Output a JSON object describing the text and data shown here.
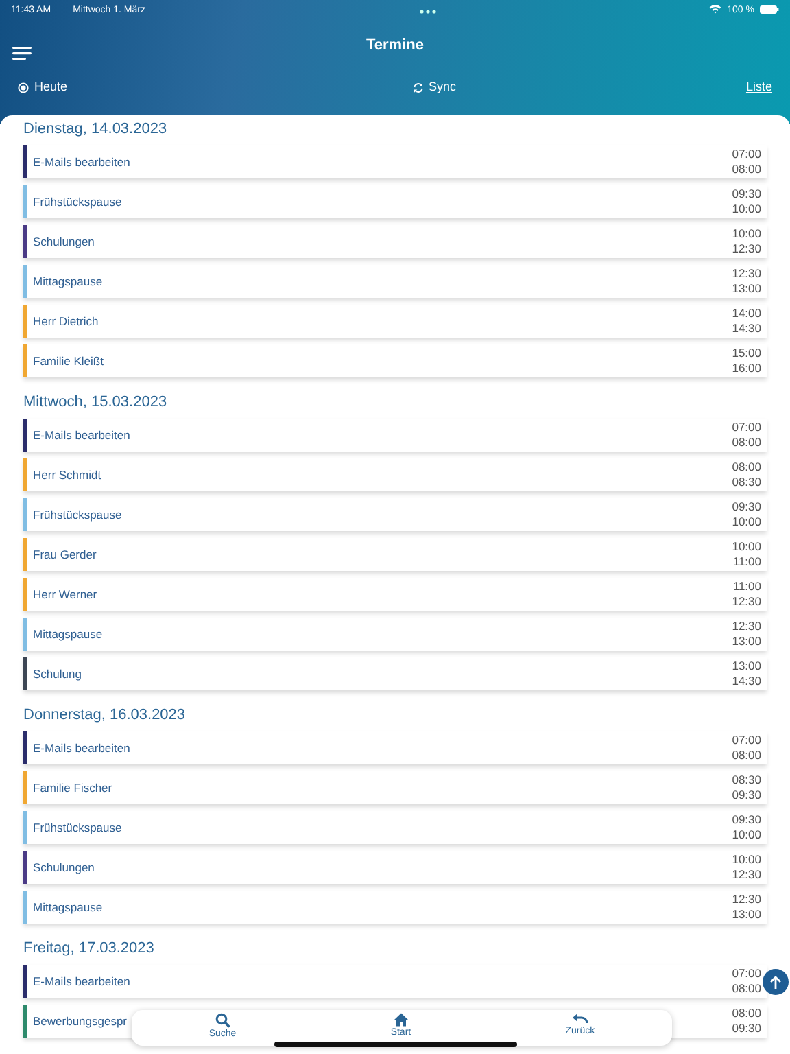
{
  "status_bar": {
    "time": "11:43 AM",
    "date": "Mittwoch 1. März",
    "battery": "100 %"
  },
  "header": {
    "title": "Termine"
  },
  "toolbar": {
    "today": "Heute",
    "sync": "Sync",
    "list": "Liste"
  },
  "days": [
    {
      "heading": "Dienstag, 14.03.2023",
      "events": [
        {
          "title": "E-Mails bearbeiten",
          "start": "07:00",
          "end": "08:00",
          "color": "#2b2d6b"
        },
        {
          "title": "Frühstückspause",
          "start": "09:30",
          "end": "10:00",
          "color": "#80bde3"
        },
        {
          "title": "Schulungen",
          "start": "10:00",
          "end": "12:30",
          "color": "#4b3b86"
        },
        {
          "title": "Mittagspause",
          "start": "12:30",
          "end": "13:00",
          "color": "#80bde3"
        },
        {
          "title": "Herr Dietrich",
          "start": "14:00",
          "end": "14:30",
          "color": "#f0a732"
        },
        {
          "title": "Familie Kleißt",
          "start": "15:00",
          "end": "16:00",
          "color": "#f0a732"
        }
      ]
    },
    {
      "heading": "Mittwoch, 15.03.2023",
      "events": [
        {
          "title": "E-Mails bearbeiten",
          "start": "07:00",
          "end": "08:00",
          "color": "#2b2d6b"
        },
        {
          "title": "Herr Schmidt",
          "start": "08:00",
          "end": "08:30",
          "color": "#f0a732"
        },
        {
          "title": "Frühstückspause",
          "start": "09:30",
          "end": "10:00",
          "color": "#80bde3"
        },
        {
          "title": "Frau Gerder",
          "start": "10:00",
          "end": "11:00",
          "color": "#f0a732"
        },
        {
          "title": "Herr Werner",
          "start": "11:00",
          "end": "12:30",
          "color": "#f0a732"
        },
        {
          "title": "Mittagspause",
          "start": "12:30",
          "end": "13:00",
          "color": "#80bde3"
        },
        {
          "title": "Schulung",
          "start": "13:00",
          "end": "14:30",
          "color": "#3d4654"
        }
      ]
    },
    {
      "heading": "Donnerstag, 16.03.2023",
      "events": [
        {
          "title": "E-Mails bearbeiten",
          "start": "07:00",
          "end": "08:00",
          "color": "#2b2d6b"
        },
        {
          "title": "Familie Fischer",
          "start": "08:30",
          "end": "09:30",
          "color": "#f0a732"
        },
        {
          "title": "Frühstückspause",
          "start": "09:30",
          "end": "10:00",
          "color": "#80bde3"
        },
        {
          "title": "Schulungen",
          "start": "10:00",
          "end": "12:30",
          "color": "#4b3b86"
        },
        {
          "title": "Mittagspause",
          "start": "12:30",
          "end": "13:00",
          "color": "#80bde3"
        }
      ]
    },
    {
      "heading": "Freitag, 17.03.2023",
      "events": [
        {
          "title": "E-Mails bearbeiten",
          "start": "07:00",
          "end": "08:00",
          "color": "#2b2d6b"
        },
        {
          "title": "Bewerbungsgespr",
          "start": "08:00",
          "end": "09:30",
          "color": "#2e8a6c"
        }
      ]
    }
  ],
  "bottom_nav": [
    {
      "label": "Suche",
      "kind": "search"
    },
    {
      "label": "Start",
      "kind": "home"
    },
    {
      "label": "Zurück",
      "kind": "back"
    }
  ]
}
